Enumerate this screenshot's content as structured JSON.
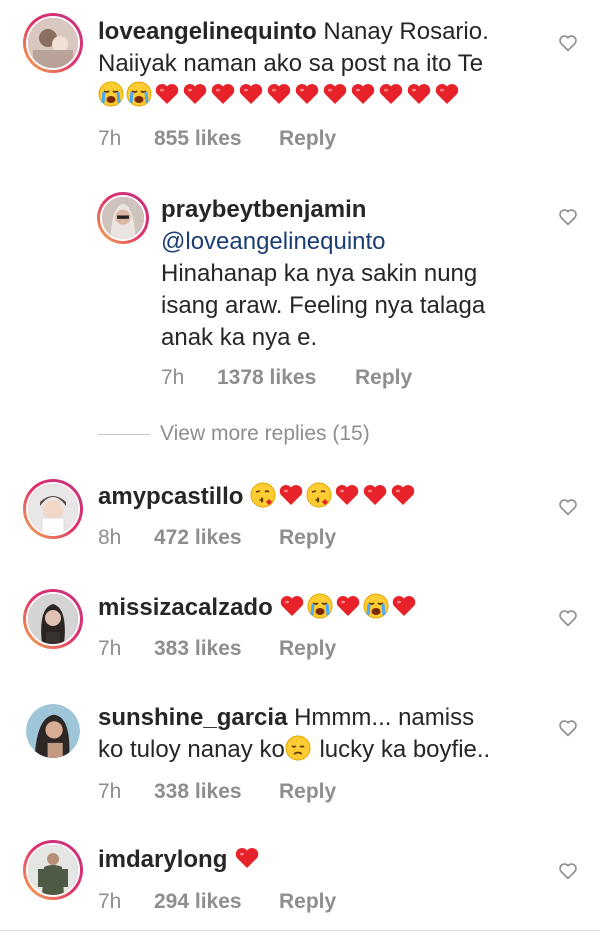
{
  "comments": [
    {
      "username": "loveangelinequinto",
      "text_line1": " Nanay Rosario.",
      "text_line2": "Naiiyak naman ako sa post na ito Te",
      "emojis": [
        "crying",
        "crying",
        "heart",
        "heart",
        "heart",
        "heart",
        "heart",
        "heart",
        "heart",
        "heart",
        "heart",
        "heart",
        "heart"
      ],
      "time": "7h",
      "likes": "855 likes",
      "reply": "Reply"
    },
    {
      "username": "amypcastillo",
      "emojis": [
        "kiss",
        "heart",
        "kiss",
        "heart",
        "heart",
        "heart"
      ],
      "time": "8h",
      "likes": "472 likes",
      "reply": "Reply"
    },
    {
      "username": "missizacalzado",
      "emojis": [
        "heart",
        "crying",
        "heart",
        "crying",
        "heart"
      ],
      "time": "7h",
      "likes": "383 likes",
      "reply": "Reply"
    },
    {
      "username": "sunshine_garcia",
      "text_line1": " Hmmm... namiss",
      "text_line2a": "ko tuloy nanay ko",
      "text_line2b": " lucky ka boyfie..",
      "time": "7h",
      "likes": "338 likes",
      "reply": "Reply"
    },
    {
      "username": "imdarylong",
      "emojis": [
        "heart"
      ],
      "time": "7h",
      "likes": "294 likes",
      "reply": "Reply"
    }
  ],
  "reply": {
    "username": "praybeytbenjamin",
    "mention": "@loveangelinequinto",
    "line1": "Hinahanap ka nya sakin nung",
    "line2": "isang araw.  Feeling nya talaga",
    "line3": "anak ka nya e.",
    "time": "7h",
    "likes": "1378 likes",
    "reply": "Reply"
  },
  "view_more": "View more replies (15)",
  "colors": {
    "heart_emoji": "#e8222a",
    "mention": "#1a3e73",
    "meta": "#8e8e8e",
    "ring": "#e1306c"
  },
  "icons": {
    "like_button": "heart-outline-icon"
  }
}
